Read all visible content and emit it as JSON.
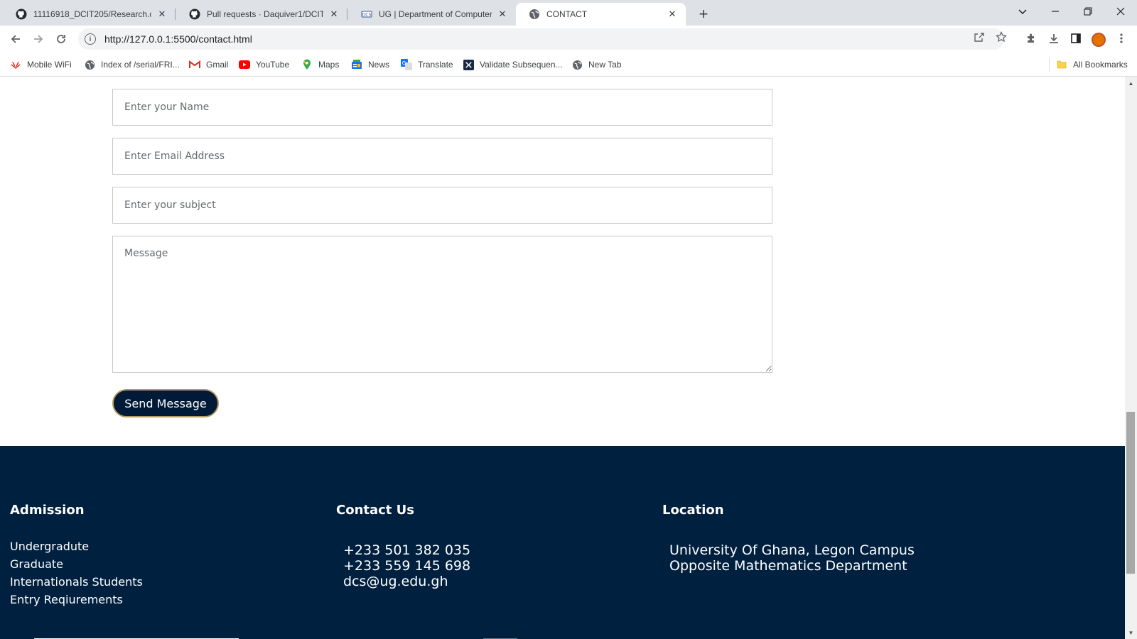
{
  "tabs": [
    {
      "title": "11116918_DCIT205/Research.cs",
      "icon": "github-icon"
    },
    {
      "title": "Pull requests · Daquiver1/DCIT_2",
      "icon": "github-icon"
    },
    {
      "title": "UG | Department of Computer S",
      "icon": "ug-icon"
    },
    {
      "title": "CONTACT",
      "icon": "globe-icon"
    }
  ],
  "address_bar": {
    "url": "http://127.0.0.1:5500/contact.html"
  },
  "bookmarks": [
    {
      "label": "Mobile WiFi",
      "icon": "huawei-icon",
      "color": "#e0231a"
    },
    {
      "label": "Index of /serial/FRI...",
      "icon": "globe-icon",
      "color": "#5f6368"
    },
    {
      "label": "Gmail",
      "icon": "gmail-icon",
      "color": "#d93025"
    },
    {
      "label": "YouTube",
      "icon": "youtube-icon",
      "color": "#ff0000"
    },
    {
      "label": "Maps",
      "icon": "maps-icon",
      "color": "#34a853"
    },
    {
      "label": "News",
      "icon": "news-icon",
      "color": "#1a73e8"
    },
    {
      "label": "Translate",
      "icon": "translate-icon",
      "color": "#1a73e8"
    },
    {
      "label": "Validate Subsequen...",
      "icon": "bookmark-x-icon",
      "color": "#1a2a44"
    },
    {
      "label": "New Tab",
      "icon": "globe-icon",
      "color": "#5f6368"
    }
  ],
  "all_bookmarks_label": "All Bookmarks",
  "form": {
    "name_placeholder": "Enter your Name",
    "email_placeholder": "Enter Email Address",
    "subject_placeholder": "Enter your subject",
    "message_placeholder": "Message",
    "send_label": "Send Message"
  },
  "footer": {
    "admission": {
      "heading": "Admission",
      "links": [
        "Undergradute",
        "Graduate",
        "Internationals Students",
        "Entry Reqiurements"
      ]
    },
    "contact": {
      "heading": "Contact Us",
      "phone1": "+233 501 382 035",
      "phone2": "+233 559 145 698",
      "email": "dcs@ug.edu.gh"
    },
    "location": {
      "heading": "Location",
      "line1": "University Of Ghana, Legon Campus",
      "line2": "Opposite Mathematics Department"
    }
  },
  "colors": {
    "footer_bg": "#00203f",
    "button_bg": "#001a38",
    "button_border": "#b59a60"
  }
}
